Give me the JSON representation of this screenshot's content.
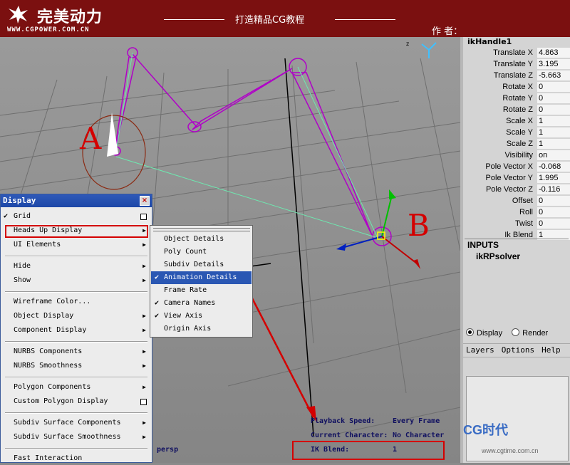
{
  "banner": {
    "logo_text": "完美动力",
    "logo_url": "WWW.CGPOWER.COM.CN",
    "title": "打造精品CG教程",
    "author": "作 者："
  },
  "viewport": {
    "camera": "persp",
    "annotation_a": "A",
    "annotation_b": "B",
    "hud": {
      "playback_speed_label": "Playback Speed:",
      "playback_speed_value": "Every Frame",
      "current_character_label": "Current Character:",
      "current_character_value": "No Character",
      "ik_blend_label": "IK Blend:",
      "ik_blend_value": "1"
    }
  },
  "display_menu": {
    "title": "Display",
    "close_glyph": "×",
    "items": [
      {
        "label": "Grid",
        "checked": true,
        "kind": "box"
      },
      {
        "label": "Heads Up Display",
        "kind": "sub"
      },
      {
        "label": "UI Elements",
        "kind": "sub"
      },
      {
        "label": "Hide",
        "kind": "sub"
      },
      {
        "label": "Show",
        "kind": "sub"
      },
      {
        "label": "Wireframe Color...",
        "kind": "plain"
      },
      {
        "label": "Object Display",
        "kind": "sub"
      },
      {
        "label": "Component Display",
        "kind": "sub"
      },
      {
        "label": "NURBS Components",
        "kind": "sub"
      },
      {
        "label": "NURBS Smoothness",
        "kind": "sub"
      },
      {
        "label": "Polygon Components",
        "kind": "sub"
      },
      {
        "label": "Custom Polygon Display",
        "kind": "box"
      },
      {
        "label": "Subdiv Surface Components",
        "kind": "sub"
      },
      {
        "label": "Subdiv Surface Smoothness",
        "kind": "sub"
      },
      {
        "label": "Fast Interaction",
        "kind": "plain"
      }
    ]
  },
  "heads_up_submenu": {
    "items": [
      {
        "label": "Object Details",
        "checked": false
      },
      {
        "label": "Poly Count",
        "checked": false
      },
      {
        "label": "Subdiv Details",
        "checked": false
      },
      {
        "label": "Animation Details",
        "checked": true,
        "active": true
      },
      {
        "label": "Frame Rate",
        "checked": false
      },
      {
        "label": "Camera Names",
        "checked": true
      },
      {
        "label": "View Axis",
        "checked": true
      },
      {
        "label": "Origin Axis",
        "checked": false
      }
    ]
  },
  "channel_box": {
    "object": "ikHandle1",
    "channels": [
      {
        "name": "Translate X",
        "value": "4.863"
      },
      {
        "name": "Translate Y",
        "value": "3.195"
      },
      {
        "name": "Translate Z",
        "value": "-5.663"
      },
      {
        "name": "Rotate X",
        "value": "0"
      },
      {
        "name": "Rotate Y",
        "value": "0"
      },
      {
        "name": "Rotate Z",
        "value": "0"
      },
      {
        "name": "Scale X",
        "value": "1"
      },
      {
        "name": "Scale Y",
        "value": "1"
      },
      {
        "name": "Scale Z",
        "value": "1"
      },
      {
        "name": "Visibility",
        "value": "on"
      },
      {
        "name": "Pole Vector X",
        "value": "-0.068"
      },
      {
        "name": "Pole Vector Y",
        "value": "1.995"
      },
      {
        "name": "Pole Vector Z",
        "value": "-0.116"
      },
      {
        "name": "Offset",
        "value": "0"
      },
      {
        "name": "Roll",
        "value": "0"
      },
      {
        "name": "Twist",
        "value": "0"
      },
      {
        "name": "Ik Blend",
        "value": "1"
      }
    ],
    "inputs_header": "INPUTS",
    "solver": "ikRPsolver"
  },
  "layer_editor": {
    "display_label": "Display",
    "render_label": "Render",
    "menu": [
      "Layers",
      "Options",
      "Help"
    ]
  },
  "watermark": {
    "text": "CG时代",
    "url": "www.cgtime.com.cn"
  },
  "colors": {
    "accent_red": "#d40000",
    "menu_highlight": "#2a57b3",
    "banner": "#7b1010",
    "wire": "#b000c8"
  }
}
